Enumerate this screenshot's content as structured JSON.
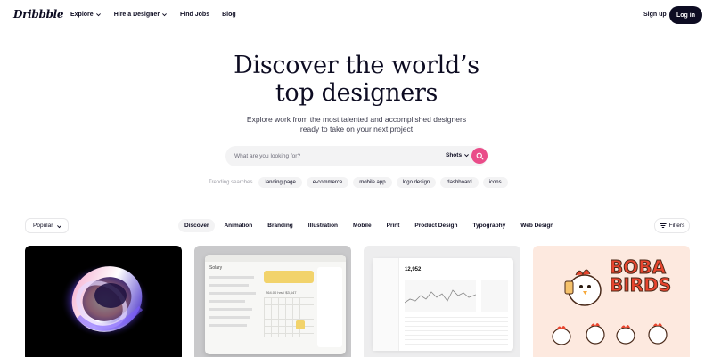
{
  "nav": {
    "logo": "Dribbble",
    "links": [
      {
        "label": "Explore",
        "has_caret": true
      },
      {
        "label": "Hire a Designer",
        "has_caret": true
      },
      {
        "label": "Find Jobs",
        "has_caret": false
      },
      {
        "label": "Blog",
        "has_caret": false
      }
    ],
    "signup": "Sign up",
    "login": "Log in"
  },
  "hero": {
    "title_line1": "Discover the world’s",
    "title_line2": "top designers",
    "subtitle_line1": "Explore work from the most talented and accomplished designers",
    "subtitle_line2": "ready to take on your next project"
  },
  "search": {
    "placeholder": "What are you looking for?",
    "value": "",
    "type": "Shots",
    "icon": "search-icon",
    "accent": "#ea4c89"
  },
  "trending": {
    "label": "Trending searches",
    "chips": [
      "landing page",
      "e-commerce",
      "mobile app",
      "logo design",
      "dashboard",
      "icons"
    ]
  },
  "filterbar": {
    "sort": "Popular",
    "categories": [
      "Discover",
      "Animation",
      "Branding",
      "Illustration",
      "Mobile",
      "Print",
      "Product Design",
      "Typography",
      "Web Design"
    ],
    "active_category": "Discover",
    "filters": "Filters"
  },
  "shots": {
    "shot2_title": "Solary",
    "shot2_value": "264.00 hrs / $3,647",
    "shot3_value": "12,952",
    "shot4_logo_line1": "BOBA",
    "shot4_logo_line2": "BIRDS"
  },
  "colors": {
    "text": "#0d0c22",
    "muted": "#6e6d7a",
    "chip_bg": "#f3f3f4",
    "accent": "#ea4c89",
    "boba_text": "#e8452e"
  }
}
